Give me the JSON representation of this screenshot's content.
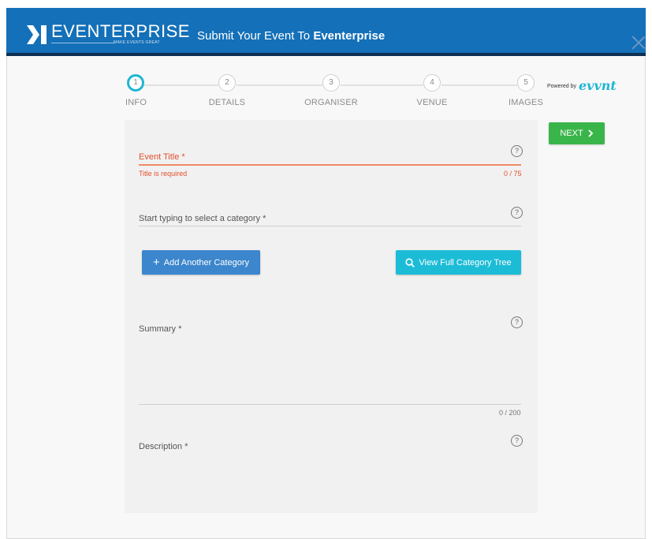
{
  "header": {
    "logo_text": "EVENTERPRISE",
    "logo_tagline": "MAKE EVENTS GREAT",
    "title_prefix": "Submit Your Event To ",
    "title_brand": "Eventerprise"
  },
  "stepper": {
    "steps": [
      {
        "number": "1",
        "label": "INFO",
        "active": true
      },
      {
        "number": "2",
        "label": "DETAILS"
      },
      {
        "number": "3",
        "label": "ORGANISER"
      },
      {
        "number": "4",
        "label": "VENUE"
      },
      {
        "number": "5",
        "label": "IMAGES"
      }
    ]
  },
  "powered": {
    "text": "Powered by",
    "brand": "evvnt"
  },
  "actions": {
    "next_label": "NEXT",
    "next_icon": "chevron-right-icon"
  },
  "form": {
    "event_title": {
      "label": "Event Title *",
      "error": "Title is required",
      "counter": "0 / 75",
      "value": ""
    },
    "category": {
      "label": "Start typing to select a category *",
      "value": ""
    },
    "add_category_label": "Add Another Category",
    "view_tree_label": "View Full Category Tree",
    "summary": {
      "label": "Summary *",
      "counter": "0 / 200",
      "value": ""
    },
    "description": {
      "label": "Description *",
      "value": ""
    },
    "help_glyph": "?"
  },
  "colors": {
    "header_bg": "#1470b8",
    "active_step": "#1eb6d3",
    "next_button": "#3ab54a",
    "error": "#e2502e",
    "add_button": "#3b86cc",
    "tree_button": "#1cbcd6"
  }
}
